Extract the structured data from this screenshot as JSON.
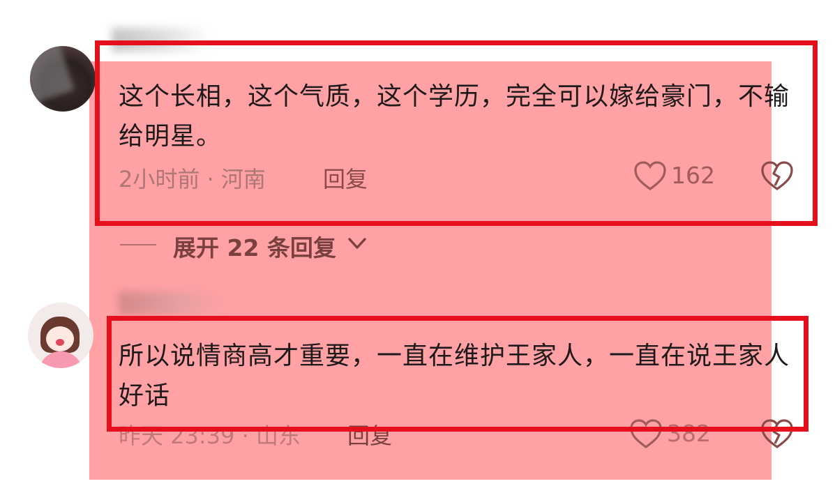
{
  "comments": [
    {
      "text": "这个长相，这个气质，这个学历，完全可以嫁给豪门，不输给明星。",
      "meta": "2小时前 · 河南",
      "reply_label": "回复",
      "likes": "162"
    },
    {
      "text": "所以说情商高才重要，一直在维护王家人，一直在说王家人好话",
      "meta": "昨天 23:39 · 山东",
      "reply_label": "回复",
      "likes": "382"
    }
  ],
  "expand_replies_label": "展开 22 条回复",
  "colors": {
    "highlight_border": "#e5101c",
    "overlay": "#ff7d82"
  },
  "icons": [
    "heart-icon",
    "broken-heart-icon",
    "chevron-down-icon"
  ]
}
